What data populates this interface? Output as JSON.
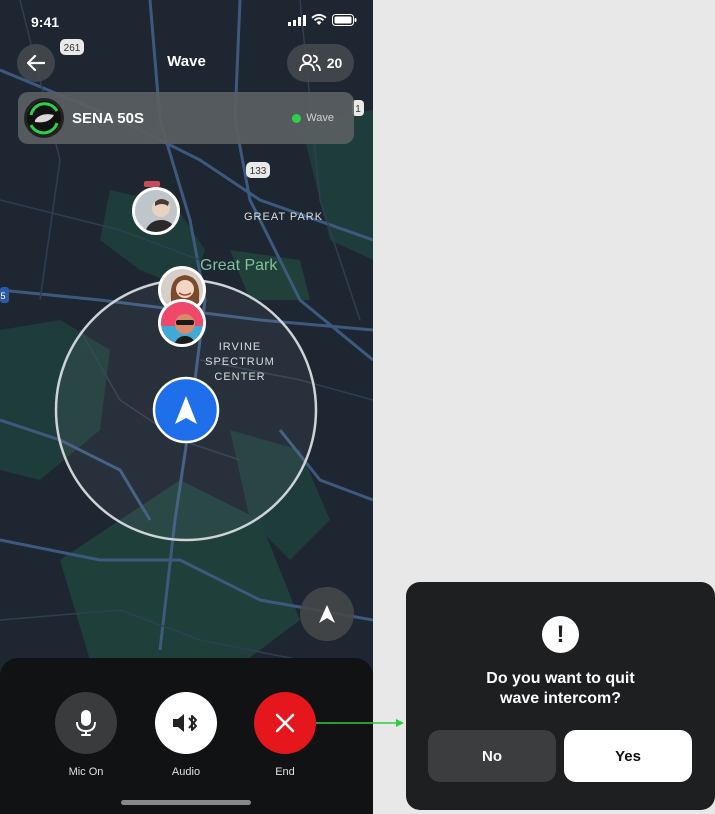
{
  "status_bar": {
    "time": "9:41"
  },
  "header": {
    "title": "Wave",
    "member_count": "20"
  },
  "device": {
    "name": "SENA 50S",
    "status": "Wave",
    "status_color": "#2ed04a"
  },
  "map": {
    "road_badges": [
      "261",
      "133",
      "5",
      "1"
    ],
    "labels": {
      "great_park_caps": "GREAT PARK",
      "great_park": "Great Park",
      "spectrum": [
        "IRVINE",
        "SPECTRUM",
        "CENTER"
      ]
    }
  },
  "controls": {
    "mic": {
      "label": "Mic On",
      "icon": "microphone-icon"
    },
    "audio": {
      "label": "Audio",
      "icon": "speaker-bluetooth-icon"
    },
    "end": {
      "label": "End",
      "icon": "close-icon",
      "color": "#e5171c"
    }
  },
  "dialog": {
    "message_line1": "Do you want to quit",
    "message_line2": "wave intercom?",
    "no_label": "No",
    "yes_label": "Yes",
    "icon": "exclamation-icon"
  },
  "colors": {
    "accent_blue": "#1f6feb",
    "connector": "#2ecc40"
  }
}
